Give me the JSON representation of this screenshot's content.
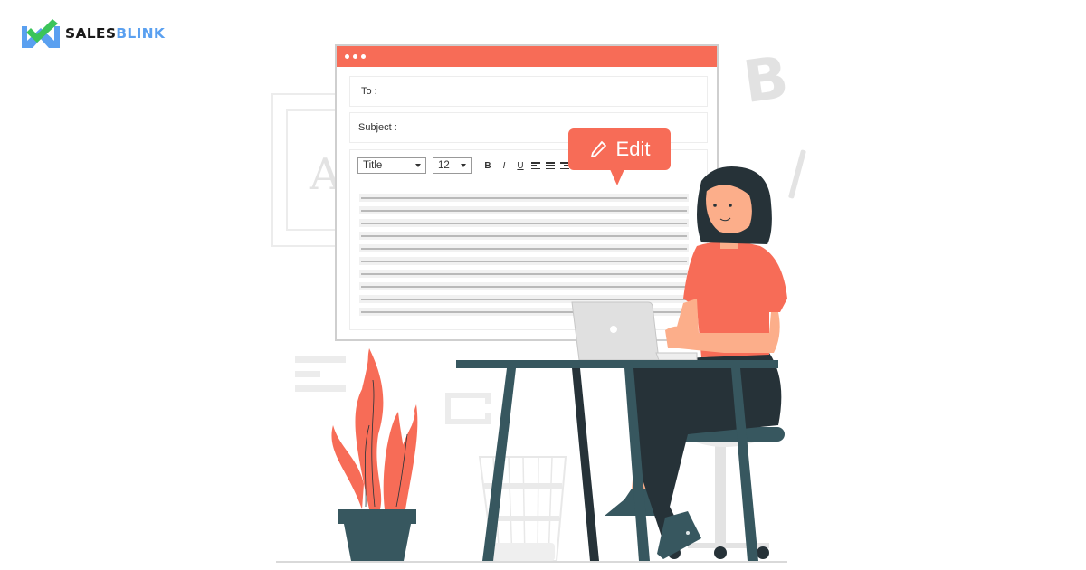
{
  "brand": {
    "name_part1": "SALES",
    "name_part2": "BLINK",
    "colors": {
      "dark": "#1a1a1a",
      "blue": "#5aa0f0",
      "check_green": "#3bc45a"
    }
  },
  "email_window": {
    "titlebar_color": "#f76c57",
    "titlebar_dots": 3,
    "to_label": "To :",
    "subject_label": "Subject :",
    "toolbar": {
      "style_select": "Title",
      "size_select": "12",
      "bold_label": "B",
      "italic_label": "I",
      "underline_label": "U",
      "align_buttons": [
        "align-left-icon",
        "align-center-icon",
        "align-right-icon"
      ]
    },
    "content_line_count": 10
  },
  "edit_tooltip": {
    "icon": "pencil-icon",
    "label": "Edit",
    "color": "#f76c57"
  },
  "decor": {
    "letter_a": "A",
    "letter_b": "B"
  },
  "illustration": {
    "subject": "woman typing on laptop at desk",
    "accent_color": "#f76c57",
    "dark_color": "#263238",
    "desk_color": "#37575f"
  }
}
